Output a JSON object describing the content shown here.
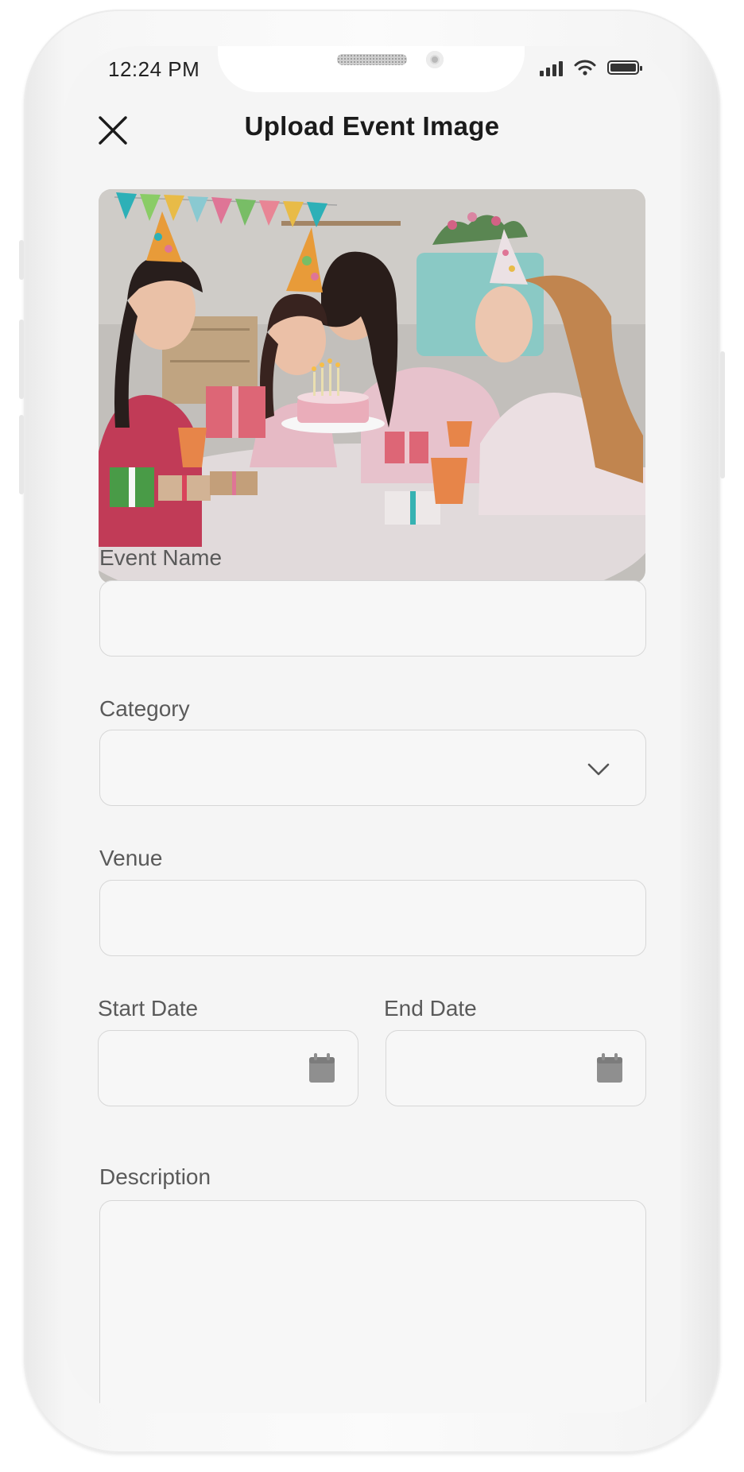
{
  "status_bar": {
    "time": "12:24 PM"
  },
  "header": {
    "title": "Upload Event Image"
  },
  "form": {
    "event_name": {
      "label": "Event Name",
      "value": ""
    },
    "category": {
      "label": "Category",
      "value": ""
    },
    "venue": {
      "label": "Venue",
      "value": ""
    },
    "start_date": {
      "label": "Start Date",
      "value": ""
    },
    "end_date": {
      "label": "End Date",
      "value": ""
    },
    "description": {
      "label": "Description",
      "value": ""
    }
  },
  "icons": {
    "close": "close-icon",
    "dropdown": "chevron-down-icon",
    "calendar": "calendar-icon",
    "signal": "signal-icon",
    "wifi": "wifi-icon",
    "battery": "battery-icon"
  },
  "colors": {
    "screen_bg": "#f5f5f5",
    "field_border": "#d7d7d7",
    "label_text": "#5a5a5a",
    "title_text": "#1b1b1b",
    "icon_gray": "#8f8f8f"
  }
}
